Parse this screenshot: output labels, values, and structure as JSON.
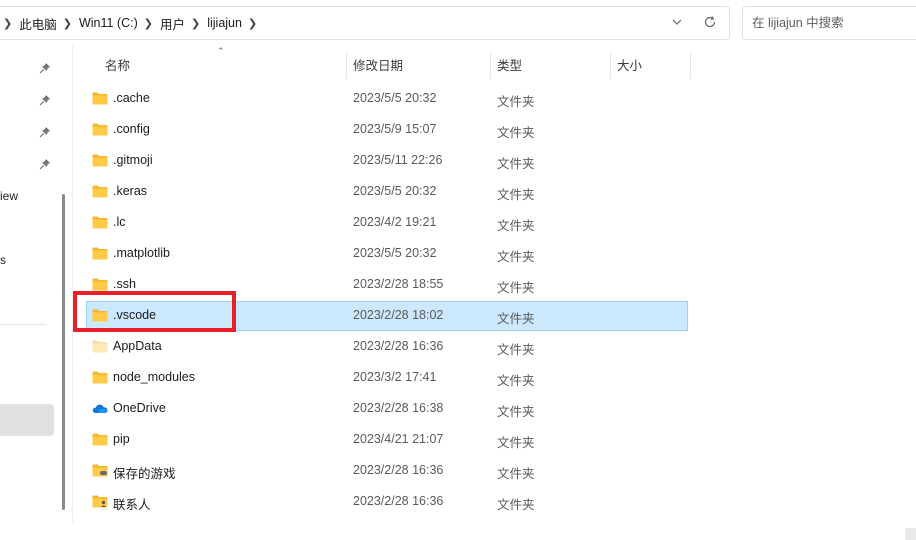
{
  "address_bar": {
    "breadcrumbs": [
      "此电脑",
      "Win11 (C:)",
      "用户",
      "lijiajun"
    ],
    "dropdown_icon": "chevron-down-icon",
    "refresh_icon": "refresh-icon"
  },
  "search": {
    "placeholder": "在 lijiajun 中搜索"
  },
  "nav": {
    "fragments": [
      "iew",
      "s"
    ],
    "pinned_icon": "pin-icon"
  },
  "columns": {
    "name": "名称",
    "modified": "修改日期",
    "type": "类型",
    "size": "大小"
  },
  "files": [
    {
      "name": ".cache",
      "modified": "2023/5/5 20:32",
      "type": "文件夹",
      "icon": "folder-icon"
    },
    {
      "name": ".config",
      "modified": "2023/5/9 15:07",
      "type": "文件夹",
      "icon": "folder-icon"
    },
    {
      "name": ".gitmoji",
      "modified": "2023/5/11 22:26",
      "type": "文件夹",
      "icon": "folder-icon"
    },
    {
      "name": ".keras",
      "modified": "2023/5/5 20:32",
      "type": "文件夹",
      "icon": "folder-icon"
    },
    {
      "name": ".lc",
      "modified": "2023/4/2 19:21",
      "type": "文件夹",
      "icon": "folder-icon"
    },
    {
      "name": ".matplotlib",
      "modified": "2023/5/5 20:32",
      "type": "文件夹",
      "icon": "folder-icon"
    },
    {
      "name": ".ssh",
      "modified": "2023/2/28 18:55",
      "type": "文件夹",
      "icon": "folder-icon"
    },
    {
      "name": ".vscode",
      "modified": "2023/2/28 18:02",
      "type": "文件夹",
      "icon": "folder-icon",
      "selected": true
    },
    {
      "name": "AppData",
      "modified": "2023/2/28 16:36",
      "type": "文件夹",
      "icon": "folder-hidden-icon"
    },
    {
      "name": "node_modules",
      "modified": "2023/3/2 17:41",
      "type": "文件夹",
      "icon": "folder-icon"
    },
    {
      "name": "OneDrive",
      "modified": "2023/2/28 16:38",
      "type": "文件夹",
      "icon": "onedrive-cloud-icon"
    },
    {
      "name": "pip",
      "modified": "2023/4/21 21:07",
      "type": "文件夹",
      "icon": "folder-icon"
    },
    {
      "name": "保存的游戏",
      "modified": "2023/2/28 16:36",
      "type": "文件夹",
      "icon": "saved-games-folder-icon"
    },
    {
      "name": "联系人",
      "modified": "2023/2/28 16:36",
      "type": "文件夹",
      "icon": "contacts-folder-icon"
    }
  ],
  "colors": {
    "selection_bg": "#cce8ff",
    "selection_border": "#99d1ff",
    "annotation_red": "#e8202a",
    "folder_yellow": "#ffc83d"
  }
}
